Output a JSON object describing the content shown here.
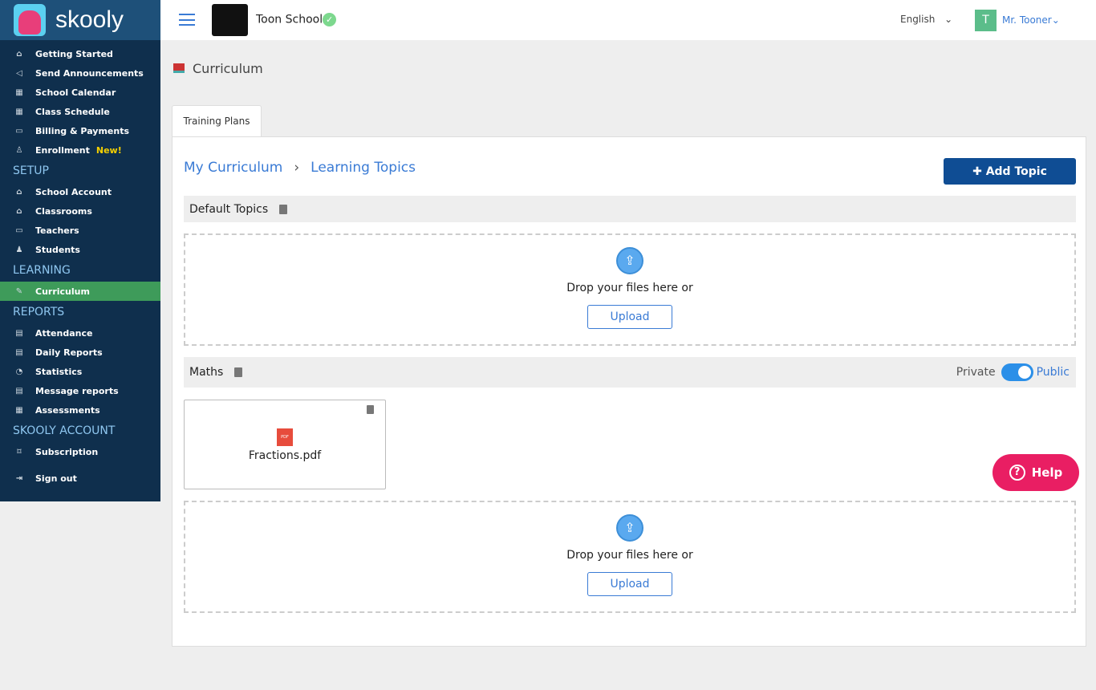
{
  "brand": "skooly",
  "sidebar": {
    "items_top": [
      {
        "label": "Getting Started",
        "icon": "home-icon"
      },
      {
        "label": "Send Announcements",
        "icon": "megaphone-icon"
      },
      {
        "label": "School Calendar",
        "icon": "calendar-icon"
      },
      {
        "label": "Class Schedule",
        "icon": "calendar-icon"
      },
      {
        "label": "Billing & Payments",
        "icon": "card-icon"
      },
      {
        "label": "Enrollment",
        "icon": "user-plus-icon",
        "badge": "New!"
      }
    ],
    "setup": "SETUP",
    "items_setup": [
      {
        "label": "School Account"
      },
      {
        "label": "Classrooms"
      },
      {
        "label": "Teachers"
      },
      {
        "label": "Students"
      }
    ],
    "learning": "LEARNING",
    "items_learning": [
      {
        "label": "Curriculum",
        "active": true
      }
    ],
    "reports": "REPORTS",
    "items_reports": [
      {
        "label": "Attendance"
      },
      {
        "label": "Daily Reports"
      },
      {
        "label": "Statistics"
      },
      {
        "label": "Message reports"
      },
      {
        "label": "Assessments"
      }
    ],
    "account": "SKOOLY ACCOUNT",
    "items_account": [
      {
        "label": "Subscription"
      }
    ],
    "signout": "Sign out"
  },
  "header": {
    "school": "Toon School",
    "language": "English",
    "avatar_initial": "T",
    "user": "Mr. Tooner"
  },
  "page": {
    "title": "Curriculum",
    "tab": "Training Plans",
    "breadcrumb": [
      "My Curriculum",
      "Learning Topics"
    ],
    "add_topic": "Add Topic"
  },
  "topics": [
    {
      "name": "Default Topics",
      "drop_text": "Drop your files here or",
      "upload": "Upload"
    },
    {
      "name": "Maths",
      "visibility_left": "Private",
      "visibility_right": "Public",
      "is_public": true,
      "files": [
        {
          "name": "Fractions.pdf"
        }
      ],
      "drop_text": "Drop your files here or",
      "upload": "Upload"
    }
  ],
  "help": "Help"
}
